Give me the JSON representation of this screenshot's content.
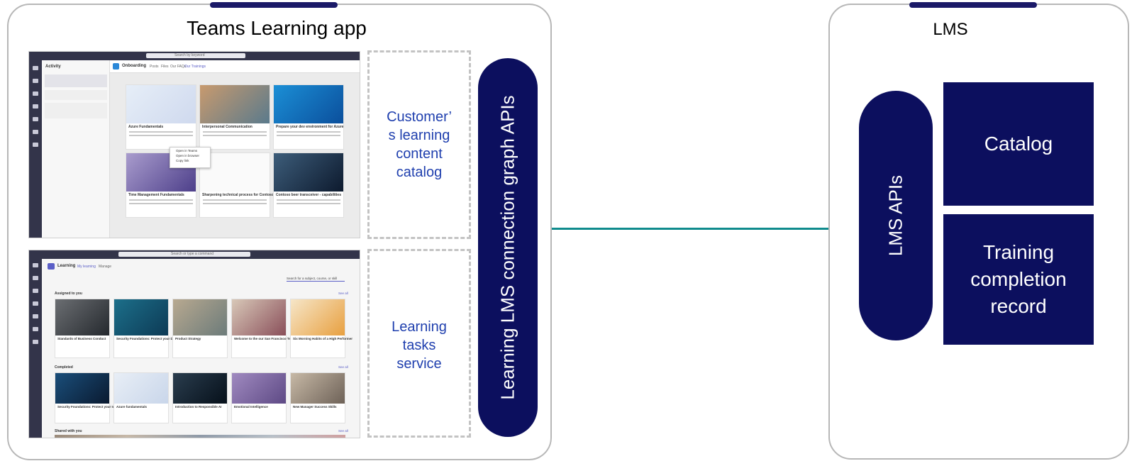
{
  "teams_panel": {
    "title": "Teams Learning app"
  },
  "customer_catalog": {
    "label": "Customer’\ns learning\ncontent\ncatalog"
  },
  "learning_tasks": {
    "label": "Learning\ntasks\nservice"
  },
  "graph_apis": {
    "label": "Learning LMS connection graph APIs"
  },
  "lms_panel": {
    "title": "LMS"
  },
  "lms_apis": {
    "label": "LMS APIs"
  },
  "catalog_box": {
    "label": "Catalog"
  },
  "training_box": {
    "label": "Training\ncompletion\nrecord"
  },
  "colors": {
    "navy": "#0c0f5e",
    "connector": "#0f8b8d",
    "link_text": "#1f3fae",
    "panel_border": "#b7b7b7"
  },
  "screenshot_top": {
    "search": "Search by keyword",
    "activity": "Activity",
    "channel": "Onboarding",
    "tabs": [
      "Posts",
      "Files",
      "Our FAQs",
      "Our Trainings"
    ],
    "cards": [
      "Azure Fundamentals",
      "Interpersonal Communication",
      "Prepare your dev environment for Azure",
      "Time Management Fundamentals",
      "Sharpening technical process for Contoso...",
      "Contoso beer transceiver - capabilities"
    ],
    "menu": [
      "Open in Teams",
      "Open in browser",
      "Copy link"
    ]
  },
  "screenshot_bottom": {
    "search": "Search or type a command",
    "app": "Learning",
    "tabs": [
      "My learning",
      "Manage"
    ],
    "search_box": "Search for a subject, course, or skill",
    "sections": [
      "Assigned to you",
      "Completed",
      "Shared with you"
    ],
    "see_all": "See all",
    "assigned": [
      "Standards of Business Conduct",
      "Security Foundations: Protect your Data",
      "Product Strategy",
      "Welcome to the our San Francisco Team",
      "Six Morning Habits of a High Performer"
    ],
    "completed": [
      "Security Foundations: Protect your Identity",
      "Azure fundamentals",
      "Introduction to Responsible AI",
      "Emotional Intelligence",
      "New Manager Success Skills"
    ]
  }
}
